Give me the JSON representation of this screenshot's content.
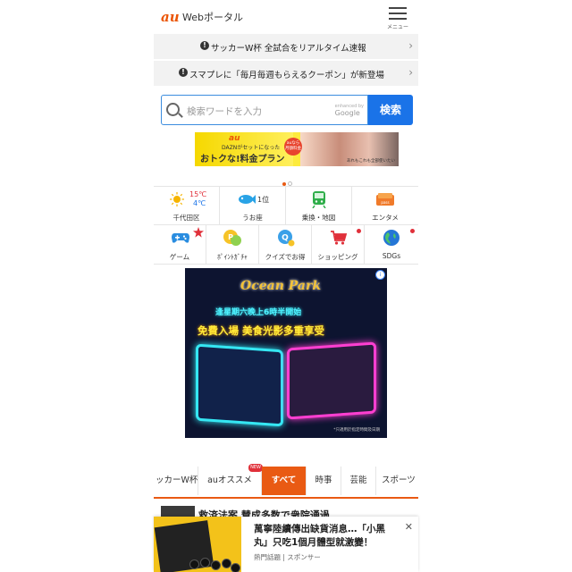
{
  "header": {
    "logo": "au",
    "title": "Webポータル",
    "menu_label": "メニュー"
  },
  "news": [
    {
      "text": "サッカーW杯 全試合をリアルタイム速報"
    },
    {
      "text": "スマプレに「毎月毎週もらえるクーポン」が新登場"
    }
  ],
  "search": {
    "placeholder": "検索ワードを入力",
    "powered_by": "enhanced by",
    "google": "Google",
    "button": "検索"
  },
  "promo": {
    "brand": "au",
    "line1": "DAZNがセットになった",
    "line2": "おトクな!料金プラン",
    "badge": "auなら 月額料金",
    "note": "あれもこれも全部使いたい"
  },
  "row1": [
    {
      "label": "千代田区",
      "temp_high": "15℃",
      "temp_low": "4℃",
      "icon": "sun-icon"
    },
    {
      "label": "うお座",
      "rank": "1位",
      "icon": "fish-icon"
    },
    {
      "label": "乗換・地図",
      "icon": "train-icon"
    },
    {
      "label": "エンタメ",
      "icon": "ticket-icon"
    }
  ],
  "row2": [
    {
      "label": "ゲーム",
      "icon": "gamepad-icon"
    },
    {
      "label": "ﾎﾟｲﾝﾄｶﾞﾁｬ",
      "icon": "gacha-icon"
    },
    {
      "label": "クイズでお得",
      "icon": "quiz-icon"
    },
    {
      "label": "ショッピング",
      "icon": "cart-icon"
    },
    {
      "label": "SDGs",
      "icon": "globe-icon"
    }
  ],
  "ad": {
    "logo": "Ocean Park",
    "line1": "逢星期六晚上6時半開始",
    "line2": "免費入場 美食光影多重享受",
    "fine": "*只適用於指定時間及日期"
  },
  "tabs": [
    "ッカーW杯",
    "auオススメ",
    "すべて",
    "時事",
    "芸能",
    "スポーツ"
  ],
  "tab_new": "NEW",
  "article": {
    "title": "救済法案 賛成多数で衆院通過"
  },
  "bottom_ad": {
    "headline": "萬寧陸續傳出缺貨消息…「小黑丸」只吃1個月體型就激變！",
    "source": "熱門話題",
    "sponsor": "スポンサー"
  },
  "colors": {
    "accent": "#e95a13",
    "search_blue": "#1a73e8",
    "au_orange": "#eb5505"
  }
}
